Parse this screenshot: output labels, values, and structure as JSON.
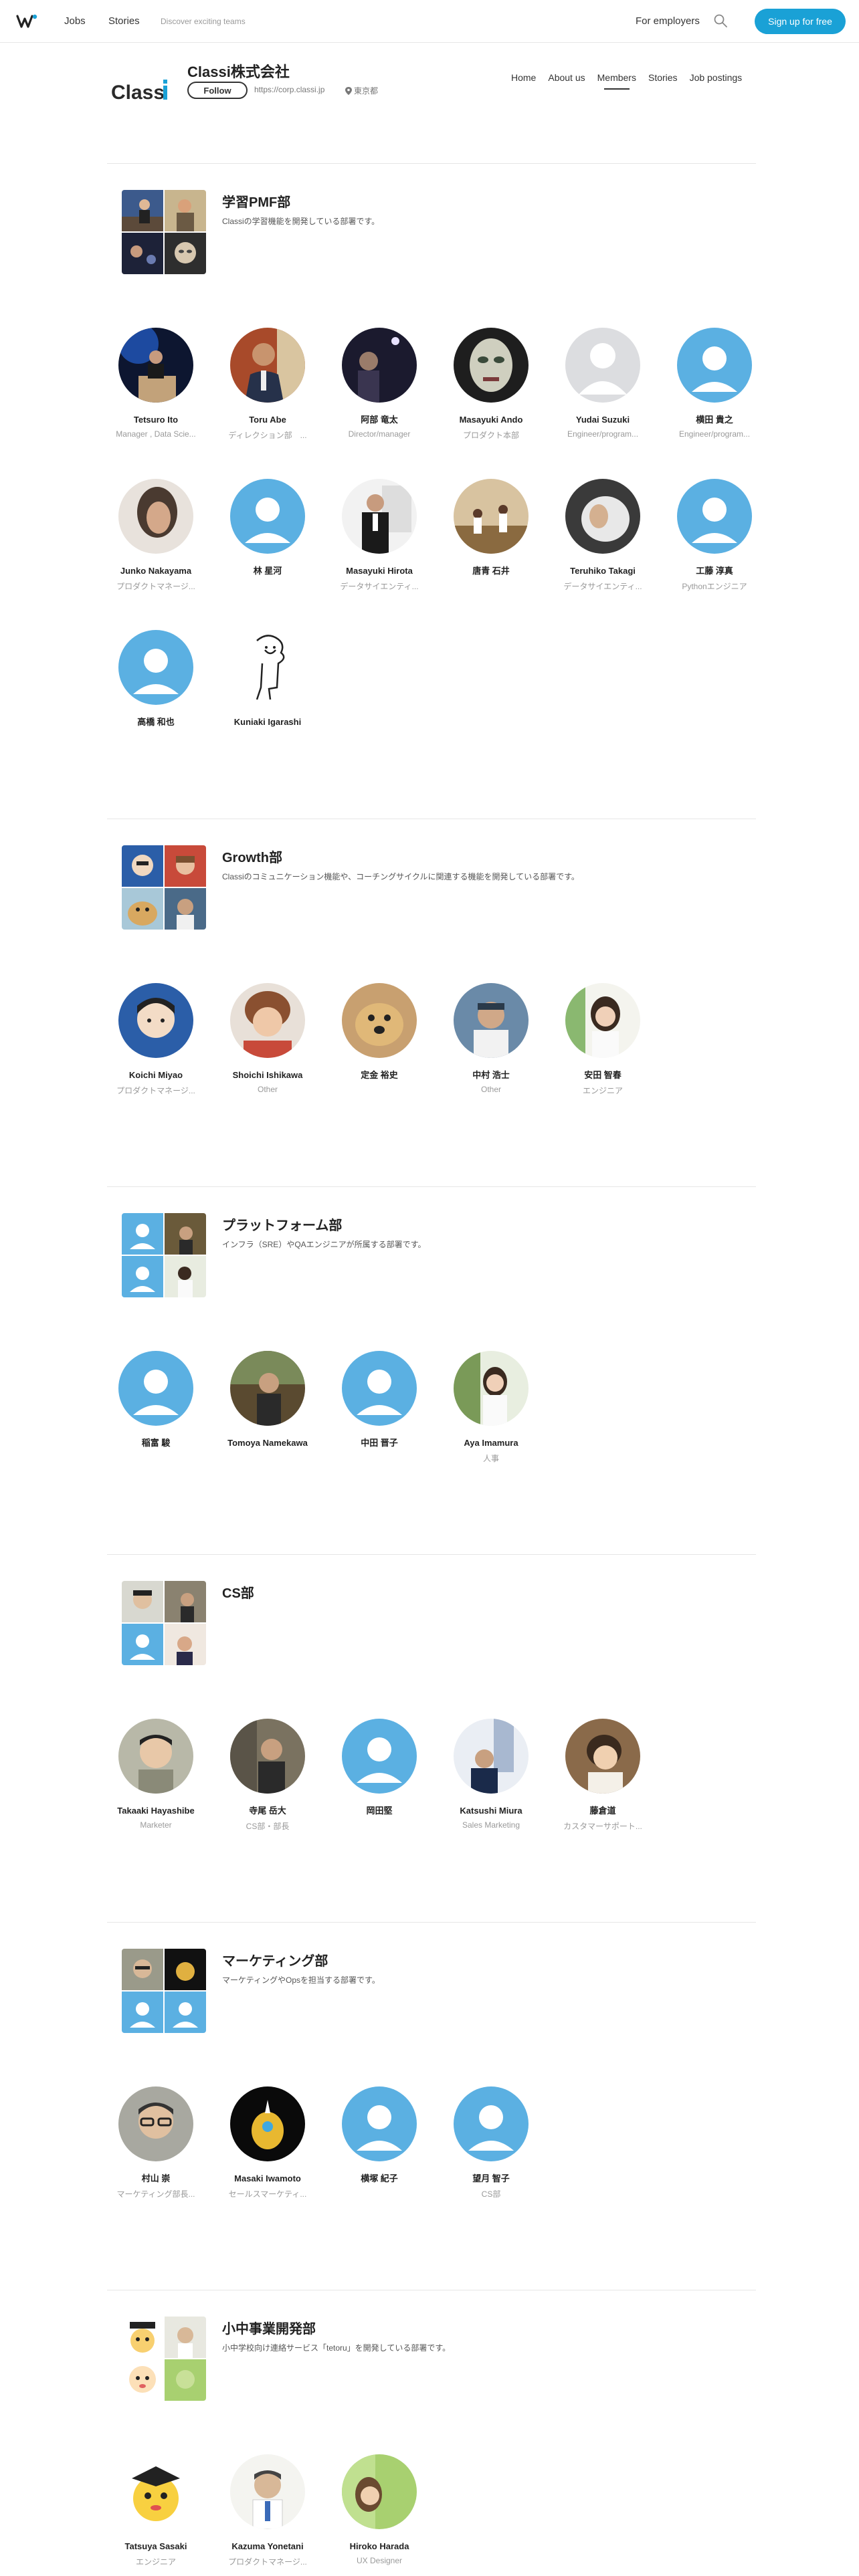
{
  "topnav": {
    "jobs": "Jobs",
    "stories": "Stories",
    "tagline": "Discover exciting teams",
    "employers": "For employers",
    "signup": "Sign up for free"
  },
  "company": {
    "name": "Classi株式会社",
    "logo_text": "Classi",
    "follow": "Follow",
    "url": "https://corp.classi.jp",
    "location": "東京都",
    "tabs": [
      "Home",
      "About us",
      "Members",
      "Stories",
      "Job postings"
    ],
    "active_tab": "Members"
  },
  "colors": {
    "brand": "#1aa1d6",
    "avatar_placeholder": "#5bb0e2",
    "logo_dark": "#2a2a2a",
    "logo_accent": "#1aa1d6"
  },
  "sections": [
    {
      "title": "学習PMF部",
      "description": "Classiの学習機能を開発している部署です。",
      "members": [
        {
          "name": "Tetsuro Ito",
          "role": "Manager , Data Scie..."
        },
        {
          "name": "Toru Abe",
          "role": "ディレクション部　..."
        },
        {
          "name": "阿部 竜太",
          "role": "Director/manager"
        },
        {
          "name": "Masayuki Ando",
          "role": "プロダクト本部"
        },
        {
          "name": "Yudai Suzuki",
          "role": "Engineer/program..."
        },
        {
          "name": "横田 貴之",
          "role": "Engineer/program..."
        },
        {
          "name": "Junko Nakayama",
          "role": "プロダクトマネージ..."
        },
        {
          "name": "林 星河",
          "role": ""
        },
        {
          "name": "Masayuki Hirota",
          "role": "データサイエンティ..."
        },
        {
          "name": "唐青 石井",
          "role": ""
        },
        {
          "name": "Teruhiko Takagi",
          "role": "データサイエンティ..."
        },
        {
          "name": "工藤 淳真",
          "role": "Pythonエンジニア"
        },
        {
          "name": "高橋 和也",
          "role": ""
        },
        {
          "name": "Kuniaki Igarashi",
          "role": ""
        }
      ]
    },
    {
      "title": "Growth部",
      "description": "Classiのコミュニケーション機能や、コーチングサイクルに関連する機能を開発している部署です。",
      "members": [
        {
          "name": "Koichi Miyao",
          "role": "プロダクトマネージ..."
        },
        {
          "name": "Shoichi Ishikawa",
          "role": "Other"
        },
        {
          "name": "定金 裕史",
          "role": ""
        },
        {
          "name": "中村 浩士",
          "role": "Other"
        },
        {
          "name": "安田 智春",
          "role": "エンジニア"
        }
      ]
    },
    {
      "title": "プラットフォーム部",
      "description": "インフラ（SRE）やQAエンジニアが所属する部署です。",
      "members": [
        {
          "name": "稲富 駿",
          "role": ""
        },
        {
          "name": "Tomoya Namekawa",
          "role": ""
        },
        {
          "name": "中田 晋子",
          "role": ""
        },
        {
          "name": "Aya Imamura",
          "role": "人事"
        }
      ]
    },
    {
      "title": "CS部",
      "description": "",
      "members": [
        {
          "name": "Takaaki Hayashibe",
          "role": "Marketer"
        },
        {
          "name": "寺尾 岳大",
          "role": "CS部・部長"
        },
        {
          "name": "岡田堅",
          "role": ""
        },
        {
          "name": "Katsushi Miura",
          "role": "Sales Marketing"
        },
        {
          "name": "藤倉道",
          "role": "カスタマーサポート..."
        }
      ]
    },
    {
      "title": "マーケティング部",
      "description": "マーケティングやOpsを担当する部署です。",
      "members": [
        {
          "name": "村山 崇",
          "role": "マーケティング部長..."
        },
        {
          "name": "Masaki Iwamoto",
          "role": "セールスマーケティ..."
        },
        {
          "name": "横塚 紀子",
          "role": ""
        },
        {
          "name": "望月 智子",
          "role": "CS部"
        }
      ]
    },
    {
      "title": "小中事業開発部",
      "description": "小中学校向け連絡サービス「tetoru」を開発している部署です。",
      "members": [
        {
          "name": "Tatsuya Sasaki",
          "role": "エンジニア"
        },
        {
          "name": "Kazuma Yonetani",
          "role": "プロダクトマネージ..."
        },
        {
          "name": "Hiroko Harada",
          "role": "UX Designer"
        }
      ]
    }
  ]
}
